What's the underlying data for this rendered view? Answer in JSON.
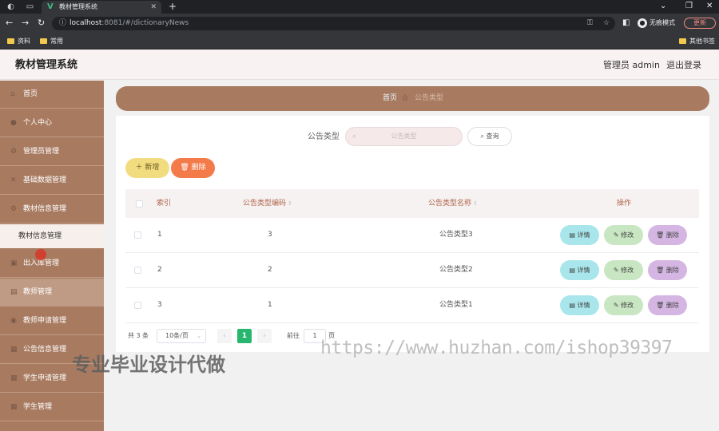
{
  "browser": {
    "tab_title": "教材管理系统",
    "url_host": "localhost",
    "url_rest": ":8081/#/dictionaryNews",
    "incognito_label": "无痕模式",
    "update_label": "更新",
    "bookmarks": [
      {
        "label": "资料"
      },
      {
        "label": "常用"
      }
    ],
    "other_bookmarks": "其他书签"
  },
  "header": {
    "title": "教材管理系统",
    "user": "管理员 admin",
    "logout": "退出登录"
  },
  "sidebar": {
    "items": [
      {
        "label": "首页",
        "icon": "home-icon"
      },
      {
        "label": "个人中心",
        "icon": "user-icon"
      },
      {
        "label": "管理员管理",
        "icon": "gear-icon"
      },
      {
        "label": "基础数据管理",
        "icon": "close-icon"
      },
      {
        "label": "教材信息管理",
        "icon": "gear-icon"
      },
      {
        "label": "出入库管理",
        "icon": "box-icon"
      },
      {
        "label": "教师管理",
        "icon": "doc-icon"
      },
      {
        "label": "教师申请管理",
        "icon": "circle-icon"
      },
      {
        "label": "公告信息管理",
        "icon": "grid-icon"
      },
      {
        "label": "学生申请管理",
        "icon": "grid-icon"
      },
      {
        "label": "学生管理",
        "icon": "grid-icon"
      }
    ],
    "sub_item": "教材信息管理"
  },
  "breadcrumb": {
    "home": "首页",
    "current": "公告类型"
  },
  "search": {
    "label": "公告类型",
    "placeholder": "公告类型",
    "query_label": "查询"
  },
  "toolbar": {
    "add_label": "新增",
    "delete_label": "删除"
  },
  "table": {
    "headers": [
      "索引",
      "公告类型编码",
      "公告类型名称",
      "操作"
    ],
    "rows": [
      {
        "index": "1",
        "code": "3",
        "name": "公告类型3"
      },
      {
        "index": "2",
        "code": "2",
        "name": "公告类型2"
      },
      {
        "index": "3",
        "code": "1",
        "name": "公告类型1"
      }
    ],
    "actions": {
      "detail": "详情",
      "edit": "修改",
      "delete": "删除"
    }
  },
  "pagination": {
    "total": "共 3 条",
    "page_size": "10条/页",
    "current_page": "1",
    "goto_label": "前往",
    "goto_value": "1",
    "page_unit": "页"
  },
  "watermark": {
    "url": "https://www.huzhan.com/ishop39397",
    "text": "专业毕业设计代做"
  },
  "colors": {
    "sidebar": "#a87b61",
    "header_bg": "#f9f2f2",
    "add_button": "#f1dc80",
    "delete_button": "#f37b4a",
    "detail_button": "#a8e6ec",
    "edit_button": "#c8e6c1",
    "row_delete_button": "#d5b6e3",
    "pager_active": "#26b66e"
  }
}
